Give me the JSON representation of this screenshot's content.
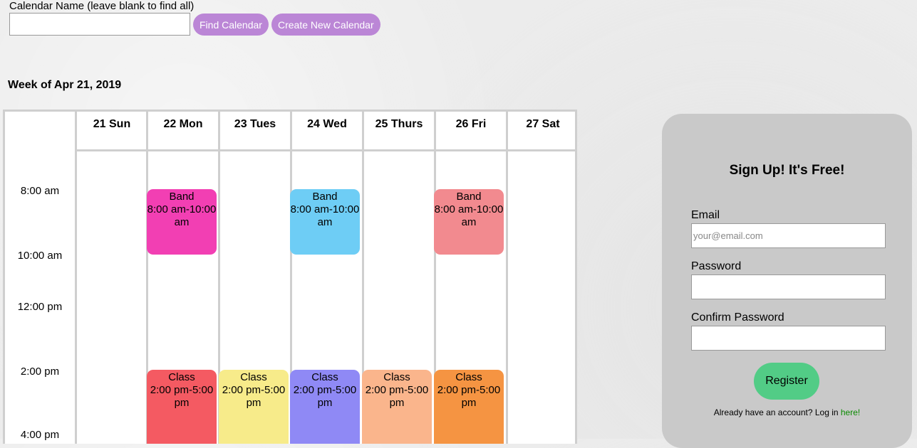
{
  "search": {
    "label": "Calendar Name (leave blank to find all)",
    "value": "",
    "find_button": "Find Calendar",
    "create_button": "Create New Calendar"
  },
  "week_title": "Week of Apr 21, 2019",
  "calendar": {
    "days": [
      "21 Sun",
      "22 Mon",
      "23 Tues",
      "24 Wed",
      "25 Thurs",
      "26 Fri",
      "27 Sat"
    ],
    "time_labels": [
      "8:00 am",
      "10:00 am",
      "12:00 pm",
      "2:00 pm",
      "4:00 pm"
    ],
    "events": [
      {
        "title": "Band",
        "start": "8:00 am",
        "end": "10:00 am",
        "day": "22 Mon",
        "color": "#f23fb3"
      },
      {
        "title": "Band",
        "start": "8:00 am",
        "end": "10:00 am",
        "day": "24 Wed",
        "color": "#6ecdf5"
      },
      {
        "title": "Band",
        "start": "8:00 am",
        "end": "10:00 am",
        "day": "26 Fri",
        "color": "#f28a8f"
      },
      {
        "title": "Class",
        "start": "2:00 pm",
        "end": "5:00 pm",
        "day": "22 Mon",
        "color": "#f45a62"
      },
      {
        "title": "Class",
        "start": "2:00 pm",
        "end": "5:00 pm",
        "day": "23 Tues",
        "color": "#f7eb8a"
      },
      {
        "title": "Class",
        "start": "2:00 pm",
        "end": "5:00 pm",
        "day": "24 Wed",
        "color": "#8f89f5"
      },
      {
        "title": "Class",
        "start": "2:00 pm",
        "end": "5:00 pm",
        "day": "25 Thurs",
        "color": "#fab58c"
      },
      {
        "title": "Class",
        "start": "2:00 pm",
        "end": "5:00 pm",
        "day": "26 Fri",
        "color": "#f59442"
      }
    ]
  },
  "signup": {
    "title": "Sign Up! It's Free!",
    "email_label": "Email",
    "email_placeholder": "your@email.com",
    "password_label": "Password",
    "confirm_label": "Confirm Password",
    "register_button": "Register",
    "login_text": "Already have an account? Log in ",
    "login_link": "here!"
  },
  "colors": {
    "button_purple": "#bb86d6",
    "register_green": "#52cc86",
    "link_green": "#0a8a00"
  }
}
